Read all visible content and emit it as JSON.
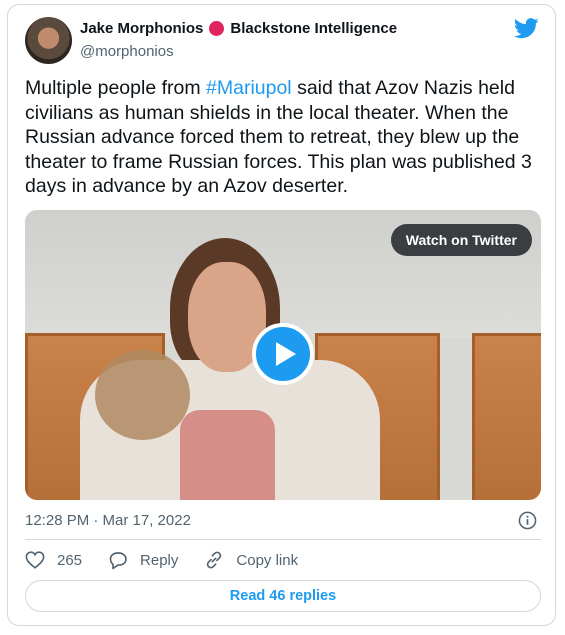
{
  "author": {
    "name": "Jake Morphonios",
    "affiliation": "Blackstone Intelligence",
    "handle": "@morphonios"
  },
  "tweet": {
    "text_before": "Multiple people from ",
    "hashtag": "#Mariupol",
    "text_after": " said that Azov Nazis held civilians as human shields in the local theater.  When the Russian advance forced them to retreat, they blew up the theater to frame Russian forces. This plan was published 3 days in advance by an Azov deserter."
  },
  "video": {
    "watch_label": "Watch on Twitter"
  },
  "timestamp": "12:28 PM · Mar 17, 2022",
  "actions": {
    "like_count": "265",
    "reply_label": "Reply",
    "copy_link_label": "Copy link"
  },
  "read_replies_label": "Read 46 replies",
  "colors": {
    "accent": "#1d9bf0",
    "badge": "#e0245e",
    "text": "#0f1419",
    "muted": "#536471"
  },
  "icons": [
    "twitter-bird-icon",
    "badge-dot-icon",
    "play-icon",
    "info-icon",
    "heart-icon",
    "reply-icon",
    "link-icon"
  ]
}
